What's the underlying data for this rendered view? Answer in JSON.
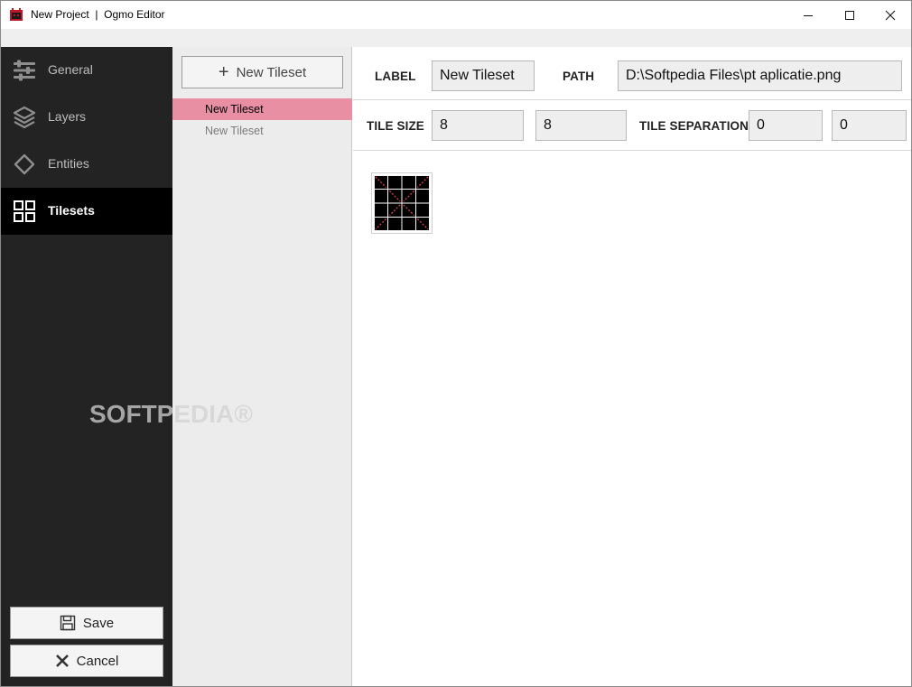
{
  "window": {
    "title": "New Project  |  Ogmo Editor",
    "controls": [
      "minimize-icon",
      "maximize-icon",
      "close-icon"
    ]
  },
  "sidebar": {
    "items": [
      {
        "label": "General",
        "icon": "sliders-icon",
        "active": false
      },
      {
        "label": "Layers",
        "icon": "layers-icon",
        "active": false
      },
      {
        "label": "Entities",
        "icon": "diamond-icon",
        "active": false
      },
      {
        "label": "Tilesets",
        "icon": "grid-icon",
        "active": true
      }
    ],
    "save_label": "Save",
    "cancel_label": "Cancel",
    "watermark": "SOFTPEDIA®"
  },
  "tileset_list": {
    "new_button_label": "New Tileset",
    "items": [
      {
        "label": "New Tileset",
        "selected": true
      },
      {
        "label": "New Tileset",
        "selected": false
      }
    ]
  },
  "editor": {
    "label_title": "LABEL",
    "label_value": "New Tileset",
    "path_title": "PATH",
    "path_value": "D:\\Softpedia Files\\pt aplicatie.png",
    "tile_size_title": "TILE SIZE",
    "tile_size_x": "8",
    "tile_size_y": "8",
    "tile_separation_title": "TILE SEPARATION",
    "tile_separation_x": "0",
    "tile_separation_y": "0"
  },
  "colors": {
    "sidebar_bg": "#232323",
    "active_bg": "#000000",
    "selected_row": "#e88fa4",
    "tile_line": "#e04050"
  }
}
